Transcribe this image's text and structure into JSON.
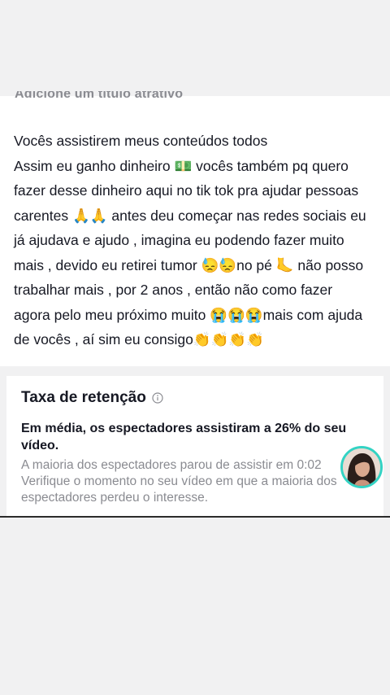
{
  "caption": {
    "title_placeholder": "Adicione um título atrativo",
    "text": "Vocês assistirem meus conteúdos todos\nAssim eu ganho dinheiro 💵 vocês também pq quero\nfazer desse dinheiro aqui no tik tok pra ajudar pessoas\ncarentes 🙏🙏 antes deu começar nas redes sociais eu\njá ajudava e ajudo , imagina eu podendo fazer muito\nmais , devido eu retirei tumor 😓😓no pé 🦶 não posso\ntrabalhar mais , por 2 anos , então não como fazer\nagora pelo meu próximo muito 😭😭😭mais com ajuda\nde vocês , aí sim eu consigo👏👏👏👏"
  },
  "retention": {
    "title": "Taxa de retenção",
    "info_icon": "info-circle-icon",
    "summary": "Em média, os espectadores assistiram a 26% do seu vídeo.",
    "desc_line1": "A maioria dos espectadores parou de assistir em 0:02",
    "desc_line2": "Verifique o momento no seu vídeo em que a maioria dos",
    "desc_line3": "espectadores perdeu o interesse."
  },
  "colors": {
    "text": "#161823",
    "muted": "#8a8b91",
    "avatar_ring": "#33d3c4",
    "background": "#f1f1f2"
  }
}
